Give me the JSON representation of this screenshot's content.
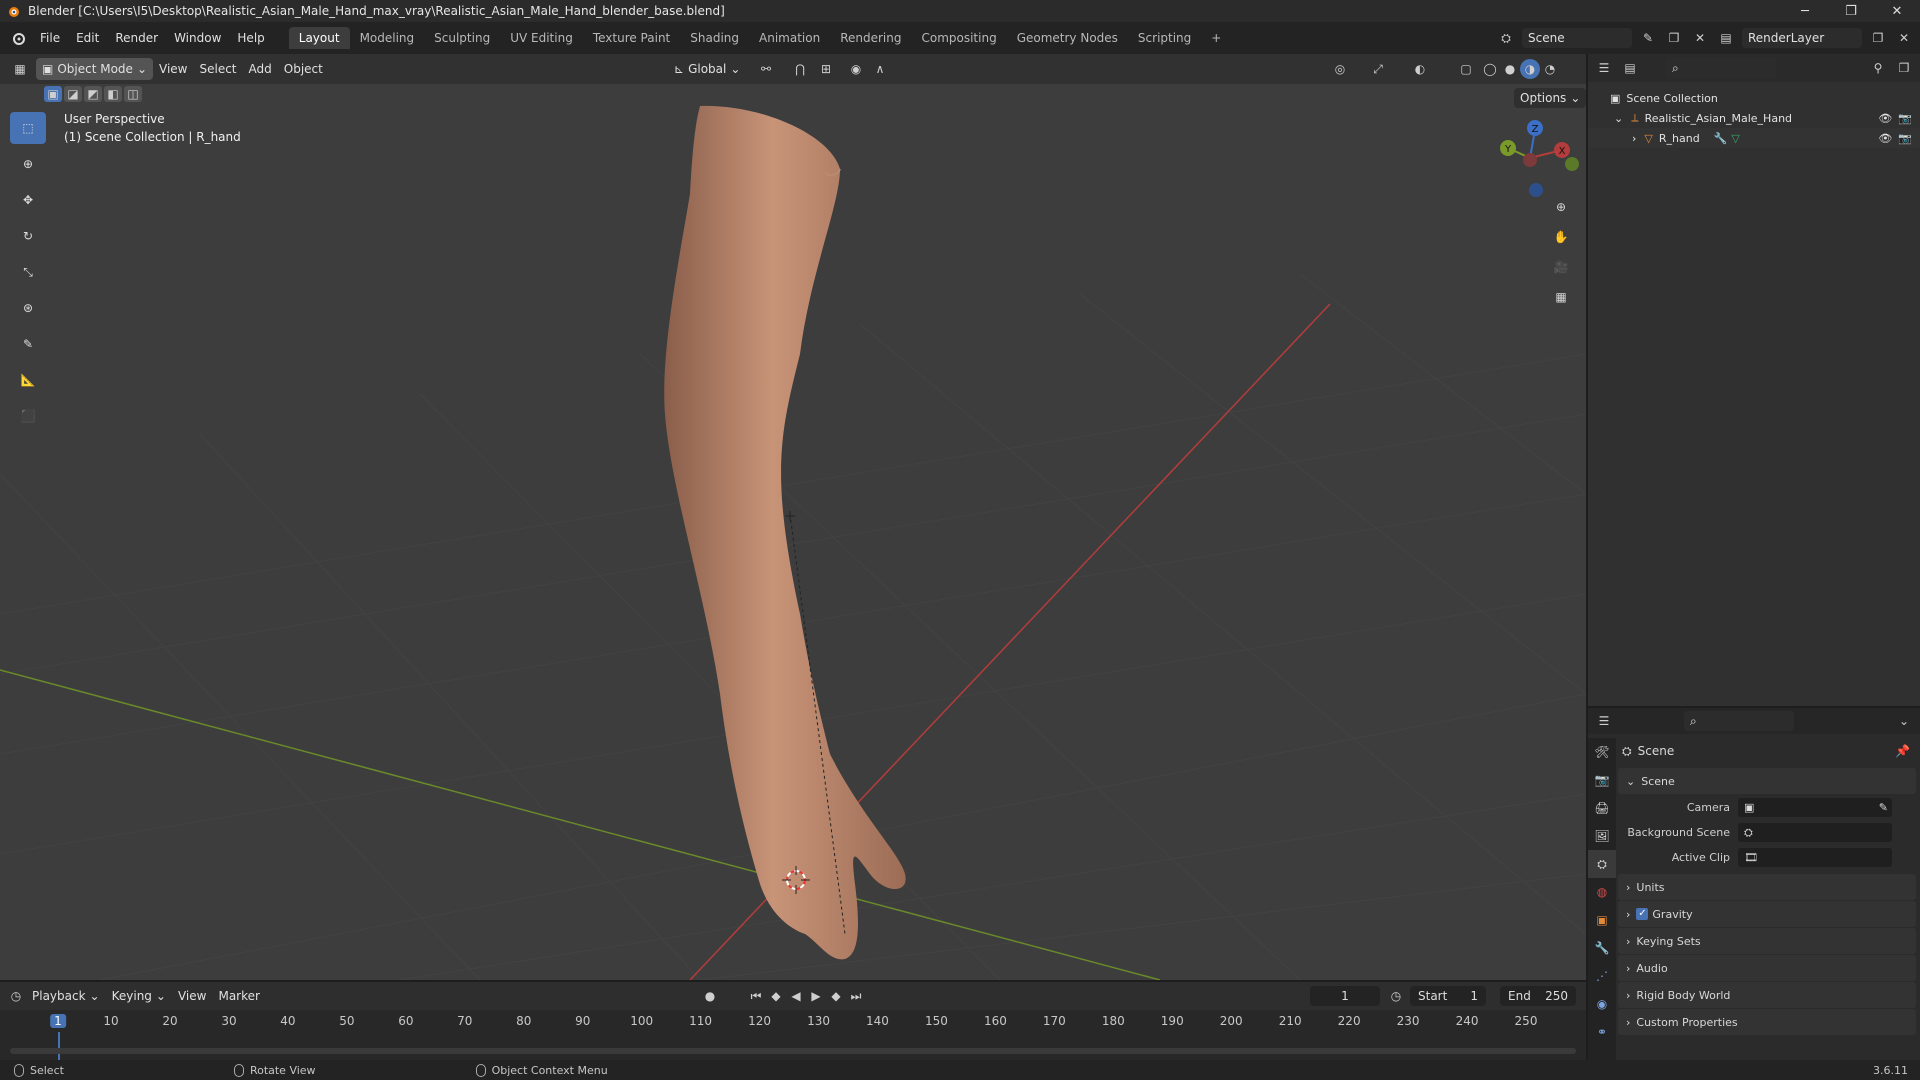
{
  "window": {
    "title": "Blender [C:\\Users\\I5\\Desktop\\Realistic_Asian_Male_Hand_max_vray\\Realistic_Asian_Male_Hand_blender_base.blend]",
    "minimize": "─",
    "maximize": "❐",
    "close": "✕"
  },
  "menu": {
    "items": [
      "File",
      "Edit",
      "Render",
      "Window",
      "Help"
    ]
  },
  "workspaces": [
    "Layout",
    "Modeling",
    "Sculpting",
    "UV Editing",
    "Texture Paint",
    "Shading",
    "Animation",
    "Rendering",
    "Compositing",
    "Geometry Nodes",
    "Scripting"
  ],
  "workspace_add": "+",
  "scene_field": "Scene",
  "renderlayer_field": "RenderLayer",
  "viewport": {
    "mode": "Object Mode",
    "menus": [
      "View",
      "Select",
      "Add",
      "Object"
    ],
    "orientation": "Global",
    "options": "Options",
    "info_line1": "User Perspective",
    "info_line2": "(1) Scene Collection | R_hand",
    "gizmo": {
      "x": "X",
      "y": "Y",
      "z": "Z"
    }
  },
  "outliner": {
    "root": "Scene Collection",
    "collection": "Realistic_Asian_Male_Hand",
    "object": "R_hand"
  },
  "properties": {
    "header": "Scene",
    "panel_scene": "Scene",
    "camera_label": "Camera",
    "bg_scene_label": "Background Scene",
    "active_clip_label": "Active Clip",
    "panels": [
      "Units",
      "Gravity",
      "Keying Sets",
      "Audio",
      "Rigid Body World",
      "Custom Properties"
    ]
  },
  "timeline": {
    "menus": [
      "Playback",
      "Keying",
      "View",
      "Marker"
    ],
    "current_frame": "1",
    "start_label": "Start",
    "start_value": "1",
    "end_label": "End",
    "end_value": "250",
    "ticks": [
      "1",
      "10",
      "20",
      "30",
      "40",
      "50",
      "60",
      "70",
      "80",
      "90",
      "100",
      "110",
      "120",
      "130",
      "140",
      "150",
      "160",
      "170",
      "180",
      "190",
      "200",
      "210",
      "220",
      "230",
      "240",
      "250"
    ]
  },
  "statusbar": {
    "select": "Select",
    "rotate": "Rotate View",
    "context_menu": "Object Context Menu",
    "version": "3.6.11"
  },
  "colors": {
    "accent": "#4772b3",
    "x_axis": "#b33c3c",
    "y_axis": "#7a9a2a",
    "z_axis": "#3b6fc8"
  }
}
